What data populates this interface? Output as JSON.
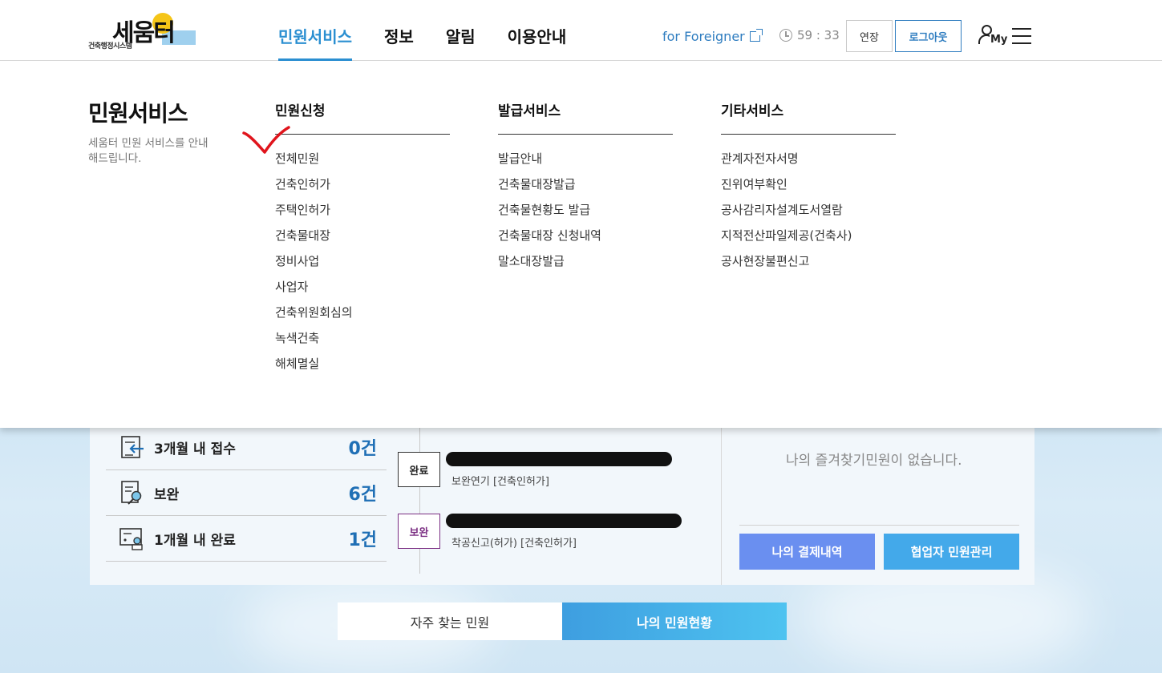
{
  "header": {
    "logo_text": "세움터",
    "logo_sub": "건축행정시스템",
    "nav": [
      "민원서비스",
      "정보",
      "알림",
      "이용안내"
    ],
    "foreigner_link": "for Foreigner",
    "timer": "59 : 33",
    "extend_label": "연장",
    "logout_label": "로그아웃",
    "my_label": "My"
  },
  "mega": {
    "title": "민원서비스",
    "desc": "세움터 민원 서비스를 안내해드립니다.",
    "columns": [
      {
        "heading": "민원신청",
        "items": [
          "전체민원",
          "건축인허가",
          "주택인허가",
          "건축물대장",
          "정비사업",
          "사업자",
          "건축위원회심의",
          "녹색건축",
          "해체멸실"
        ]
      },
      {
        "heading": "발급서비스",
        "items": [
          "발급안내",
          "건축물대장발급",
          "건축물현황도 발급",
          "건축물대장 신청내역",
          "말소대장발급"
        ]
      },
      {
        "heading": "기타서비스",
        "items": [
          "관계자전자서명",
          "진위여부확인",
          "공사감리자설계도서열람",
          "지적전산파일제공(건축사)",
          "공사현장불편신고"
        ]
      }
    ]
  },
  "dashboard": {
    "stats": [
      {
        "label": "3개월 내 접수",
        "value": "0건"
      },
      {
        "label": "보완",
        "value": "6건"
      },
      {
        "label": "1개월 내 완료",
        "value": "1건"
      }
    ],
    "cases": [
      {
        "badge": "완료",
        "sub": "보완연기 [건축인허가]"
      },
      {
        "badge": "보완",
        "sub": "착공신고(허가) [건축인허가]"
      }
    ],
    "favorites_empty": "나의 즐겨찾기민원이 없습니다.",
    "btn_payment": "나의 결제내역",
    "btn_partner": "협업자 민원관리"
  },
  "tabs": {
    "frequent": "자주 찾는 민원",
    "my_status": "나의 민원현황"
  },
  "colors": {
    "accent": "#2b8fd1",
    "button_payment": "#6a8ff0",
    "button_partner": "#43a9ea",
    "supplement_badge": "#7b2f83"
  }
}
